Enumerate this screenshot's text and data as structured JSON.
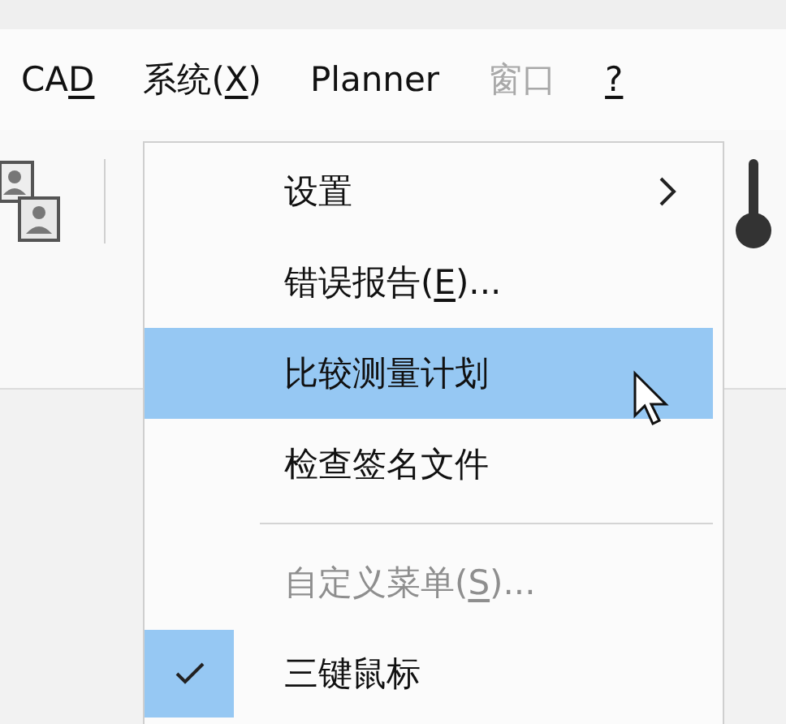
{
  "menu_bar": [
    {
      "parts": [
        {
          "text": "CA",
          "underline": false
        },
        {
          "text": "D",
          "underline": true
        }
      ],
      "disabled": false
    },
    {
      "parts": [
        {
          "text": "系统(",
          "underline": false
        },
        {
          "text": "X",
          "underline": true
        },
        {
          "text": ")",
          "underline": false
        }
      ],
      "disabled": false
    },
    {
      "parts": [
        {
          "text": "Planner",
          "underline": false
        }
      ],
      "disabled": false
    },
    {
      "parts": [
        {
          "text": "窗口",
          "underline": false
        }
      ],
      "disabled": true
    },
    {
      "parts": [
        {
          "text": "?",
          "underline": true
        }
      ],
      "disabled": false
    }
  ],
  "dropdown_menu": [
    {
      "kind": "item",
      "parts": [
        {
          "text": "设置",
          "underline": false
        }
      ],
      "submenu": true,
      "selected": false,
      "disabled": false,
      "checked": false
    },
    {
      "kind": "item",
      "parts": [
        {
          "text": "错误报告(",
          "underline": false
        },
        {
          "text": "E",
          "underline": true
        },
        {
          "text": ")...",
          "underline": false
        }
      ],
      "submenu": false,
      "selected": false,
      "disabled": false,
      "checked": false
    },
    {
      "kind": "item",
      "parts": [
        {
          "text": "比较测量计划",
          "underline": false
        }
      ],
      "submenu": false,
      "selected": true,
      "disabled": false,
      "checked": false
    },
    {
      "kind": "item",
      "parts": [
        {
          "text": "检查签名文件",
          "underline": false
        }
      ],
      "submenu": false,
      "selected": false,
      "disabled": false,
      "checked": false
    },
    {
      "kind": "separator"
    },
    {
      "kind": "item",
      "parts": [
        {
          "text": "自定义菜单(",
          "underline": false
        },
        {
          "text": "S",
          "underline": true
        },
        {
          "text": ")...",
          "underline": false
        }
      ],
      "submenu": false,
      "selected": false,
      "disabled": true,
      "checked": false
    },
    {
      "kind": "item",
      "parts": [
        {
          "text": "三键鼠标",
          "underline": false
        }
      ],
      "submenu": false,
      "selected": false,
      "disabled": false,
      "checked": true
    }
  ]
}
